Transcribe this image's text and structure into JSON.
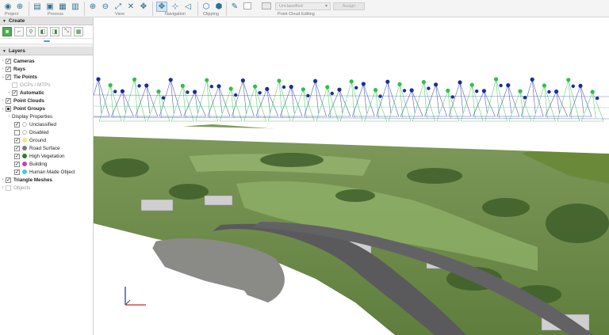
{
  "toolbar": {
    "groups": {
      "project": "Project",
      "process": "Process",
      "view": "View",
      "navigation": "Navigation",
      "clipping": "Clipping",
      "point_cloud_editing": "Point Cloud Editing"
    },
    "classification_select": {
      "value": "Unclassified"
    },
    "assign_label": "Assign"
  },
  "create": {
    "title": "Create"
  },
  "layers": {
    "title": "Layers",
    "items": [
      {
        "label": "Cameras",
        "bold": true
      },
      {
        "label": "Rays",
        "bold": true
      },
      {
        "label": "Tie Points",
        "bold": true
      },
      {
        "label": "GCPs / MTPs",
        "greyed": true
      },
      {
        "label": "Automatic",
        "bold": true
      },
      {
        "label": "Point Clouds",
        "bold": true
      },
      {
        "label": "Point Groups",
        "bold": true
      },
      {
        "label": "Display Properties"
      },
      {
        "label": "Unclassified",
        "color": "#ffffff"
      },
      {
        "label": "Disabled",
        "color": "#ffffff"
      },
      {
        "label": "Ground",
        "color": "#f3e58a"
      },
      {
        "label": "Road Surface",
        "color": "#7a7a7a"
      },
      {
        "label": "High Vegetation",
        "color": "#2e7d32"
      },
      {
        "label": "Building",
        "color": "#d23bb5"
      },
      {
        "label": "Human Made Object",
        "color": "#3fd0d4"
      },
      {
        "label": "Triangle Meshes",
        "bold": true
      },
      {
        "label": "Objects",
        "greyed": true
      }
    ]
  },
  "colors": {
    "camera_blue": "#1a2e9a",
    "camera_green": "#2fbf4a",
    "grass": "#6d8a4a",
    "road": "#5a5a5c",
    "accent": "#2f6f8f"
  }
}
